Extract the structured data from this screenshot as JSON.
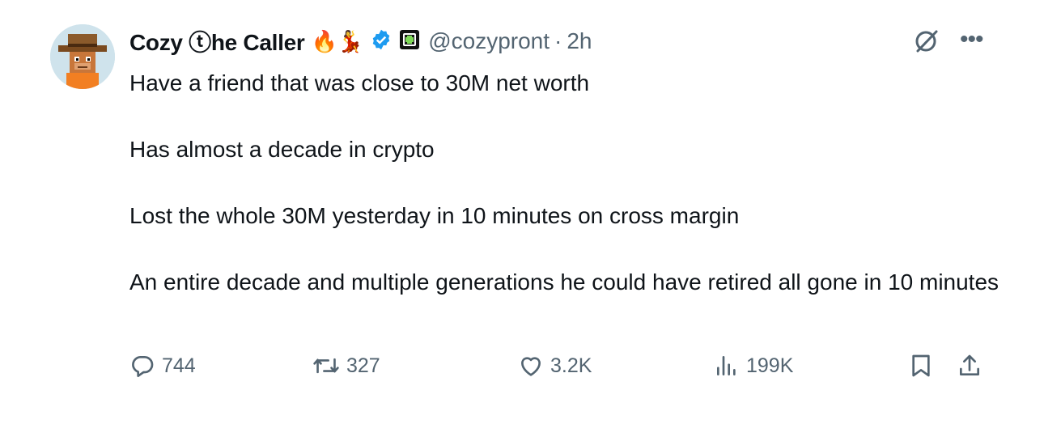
{
  "author": {
    "name": "Cozy ⓣhe Caller",
    "emojis": "🔥💃",
    "handle": "@cozypront",
    "separator": "·",
    "time": "2h"
  },
  "tweet": {
    "paragraphs": [
      "Have a friend that was close to 30M net worth",
      "Has almost a decade in crypto",
      "Lost the whole 30M yesterday in 10 minutes on cross margin",
      "An entire decade and multiple generations he could have retired all gone in 10 minutes"
    ]
  },
  "actions": {
    "replies": "744",
    "reposts": "327",
    "likes": "3.2K",
    "views": "199K"
  },
  "icons": [
    "avatar",
    "verified-badge-icon",
    "affiliate-badge-icon",
    "grok-icon",
    "more-icon",
    "reply-icon",
    "repost-icon",
    "like-icon",
    "views-icon",
    "bookmark-icon",
    "share-icon"
  ],
  "colors": {
    "verified": "#1d9bf0",
    "secondary_text": "#536471",
    "text": "#0f1419"
  }
}
